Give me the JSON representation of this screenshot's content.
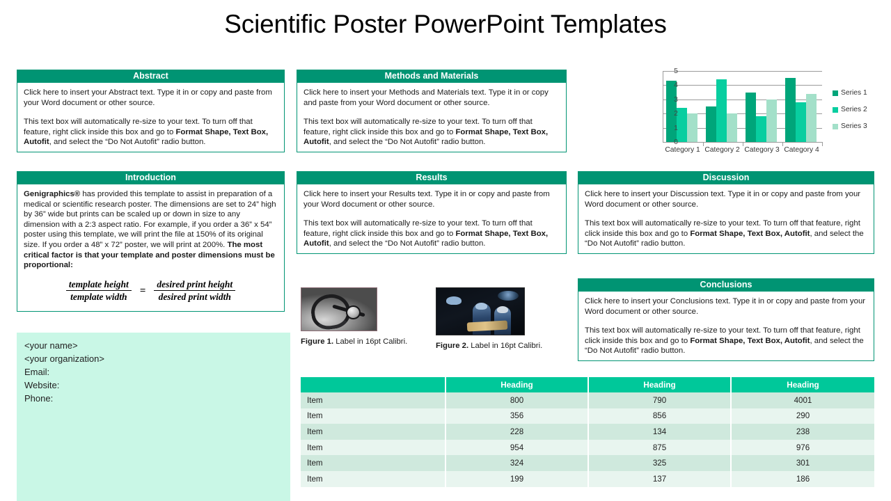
{
  "title": "Scientific Poster PowerPoint Templates",
  "colors": {
    "header_green": "#009473",
    "table_header_green": "#00C89A",
    "contact_box_green": "#C9F7E6",
    "row_odd": "#CFE9DD",
    "row_even": "#E8F5EF",
    "series_1": "#00A57A",
    "series_2": "#08CEA0",
    "series_3": "#A3E0C9"
  },
  "sections": {
    "abstract": {
      "heading": "Abstract",
      "paragraph_1": "Click here to insert your Abstract text.  Type it in or copy and paste from your Word document or other source.",
      "paragraph_2_part_1": "This text box will automatically re-size to your text.  To turn off that feature, right click inside this box and go to ",
      "paragraph_2_bold": "Format Shape, Text Box, Autofit",
      "paragraph_2_part_2": ", and select the “Do Not Autofit” radio button."
    },
    "methods": {
      "heading": "Methods and Materials",
      "paragraph_1": "Click here to insert your Methods and Materials text. Type it in or copy and paste from your Word document or other source.",
      "paragraph_2_part_1": "This text box will automatically re-size to your text.  To turn off that feature, right click inside this box and go to ",
      "paragraph_2_bold": "Format Shape, Text Box, Autofit",
      "paragraph_2_part_2": ", and select the “Do Not Autofit” radio button."
    },
    "introduction": {
      "heading": "Introduction",
      "body_bold_lead": "Genigraphics®",
      "body_text": " has provided this template to assist in preparation of a medical or scientific research poster. The dimensions are set to 24” high by 36” wide but prints can be scaled up or down in size to any dimension with a 2:3 aspect ratio. For example, if you order a 36” x 54” poster using this template, we will print the file at 150% of its original size. If you order a 48” x 72” poster, we will print at 200%. ",
      "body_bold_tail": "The most critical factor is that your template and poster dimensions must be proportional:",
      "formula": {
        "left_numerator": "template height",
        "left_denominator": "template width",
        "operator": "=",
        "right_numerator": "desired print height",
        "right_denominator": "desired print width"
      }
    },
    "results": {
      "heading": "Results",
      "paragraph_1": "Click here to insert your Results text. Type it in or copy and paste from your Word document or other source.",
      "paragraph_2_part_1": "This text box will automatically re-size to your text.  To turn off that feature, right click inside this box and go to ",
      "paragraph_2_bold": "Format Shape, Text Box, Autofit",
      "paragraph_2_part_2": ", and select the “Do Not Autofit” radio button."
    },
    "discussion": {
      "heading": "Discussion",
      "paragraph_1": "Click here to insert your Discussion text. Type it in or copy and paste from your Word document or other source.",
      "paragraph_2_part_1": "This text box will automatically re-size to your text.  To turn off that feature, right click inside this box and go to ",
      "paragraph_2_bold": "Format Shape, Text Box, Autofit",
      "paragraph_2_part_2": ", and select the “Do Not Autofit” radio button."
    },
    "conclusions": {
      "heading": "Conclusions",
      "paragraph_1": "Click here to insert your Conclusions text. Type it in or copy and paste from your Word document or other source.",
      "paragraph_2_part_1": "This text box will automatically re-size to your text.  To turn off that feature, right click inside this box and go to ",
      "paragraph_2_bold": "Format Shape, Text Box, Autofit",
      "paragraph_2_part_2": ", and select the “Do Not Autofit” radio button."
    }
  },
  "contact": {
    "name": "<your name>",
    "organization": "<your organization>",
    "email_label": "Email:",
    "website_label": "Website:",
    "phone_label": "Phone:"
  },
  "figures": [
    {
      "label_bold": "Figure 1.",
      "caption": " Label in 16pt Calibri.",
      "image_name": "stethoscope-photo"
    },
    {
      "label_bold": "Figure 2.",
      "caption": " Label in 16pt Calibri.",
      "image_name": "surgery-operating-room-photo"
    }
  ],
  "chart_data": {
    "type": "bar",
    "title": "",
    "xlabel": "",
    "ylabel": "",
    "ylim": [
      0,
      5
    ],
    "yticks": [
      0,
      1,
      2,
      3,
      4,
      5
    ],
    "grid": true,
    "legend_position": "right",
    "categories": [
      "Category 1",
      "Category 2",
      "Category 3",
      "Category 4"
    ],
    "series": [
      {
        "name": "Series 1",
        "color": "#00A57A",
        "values": [
          4.3,
          2.5,
          3.5,
          4.5
        ]
      },
      {
        "name": "Series 2",
        "color": "#08CEA0",
        "values": [
          2.4,
          4.4,
          1.8,
          2.8
        ]
      },
      {
        "name": "Series 3",
        "color": "#A3E0C9",
        "values": [
          2.0,
          2.0,
          3.0,
          3.4
        ]
      }
    ]
  },
  "table": {
    "headers": [
      "",
      "Heading",
      "Heading",
      "Heading"
    ],
    "rows": [
      [
        "Item",
        "800",
        "790",
        "4001"
      ],
      [
        "Item",
        "356",
        "856",
        "290"
      ],
      [
        "Item",
        "228",
        "134",
        "238"
      ],
      [
        "Item",
        "954",
        "875",
        "976"
      ],
      [
        "Item",
        "324",
        "325",
        "301"
      ],
      [
        "Item",
        "199",
        "137",
        "186"
      ]
    ]
  }
}
